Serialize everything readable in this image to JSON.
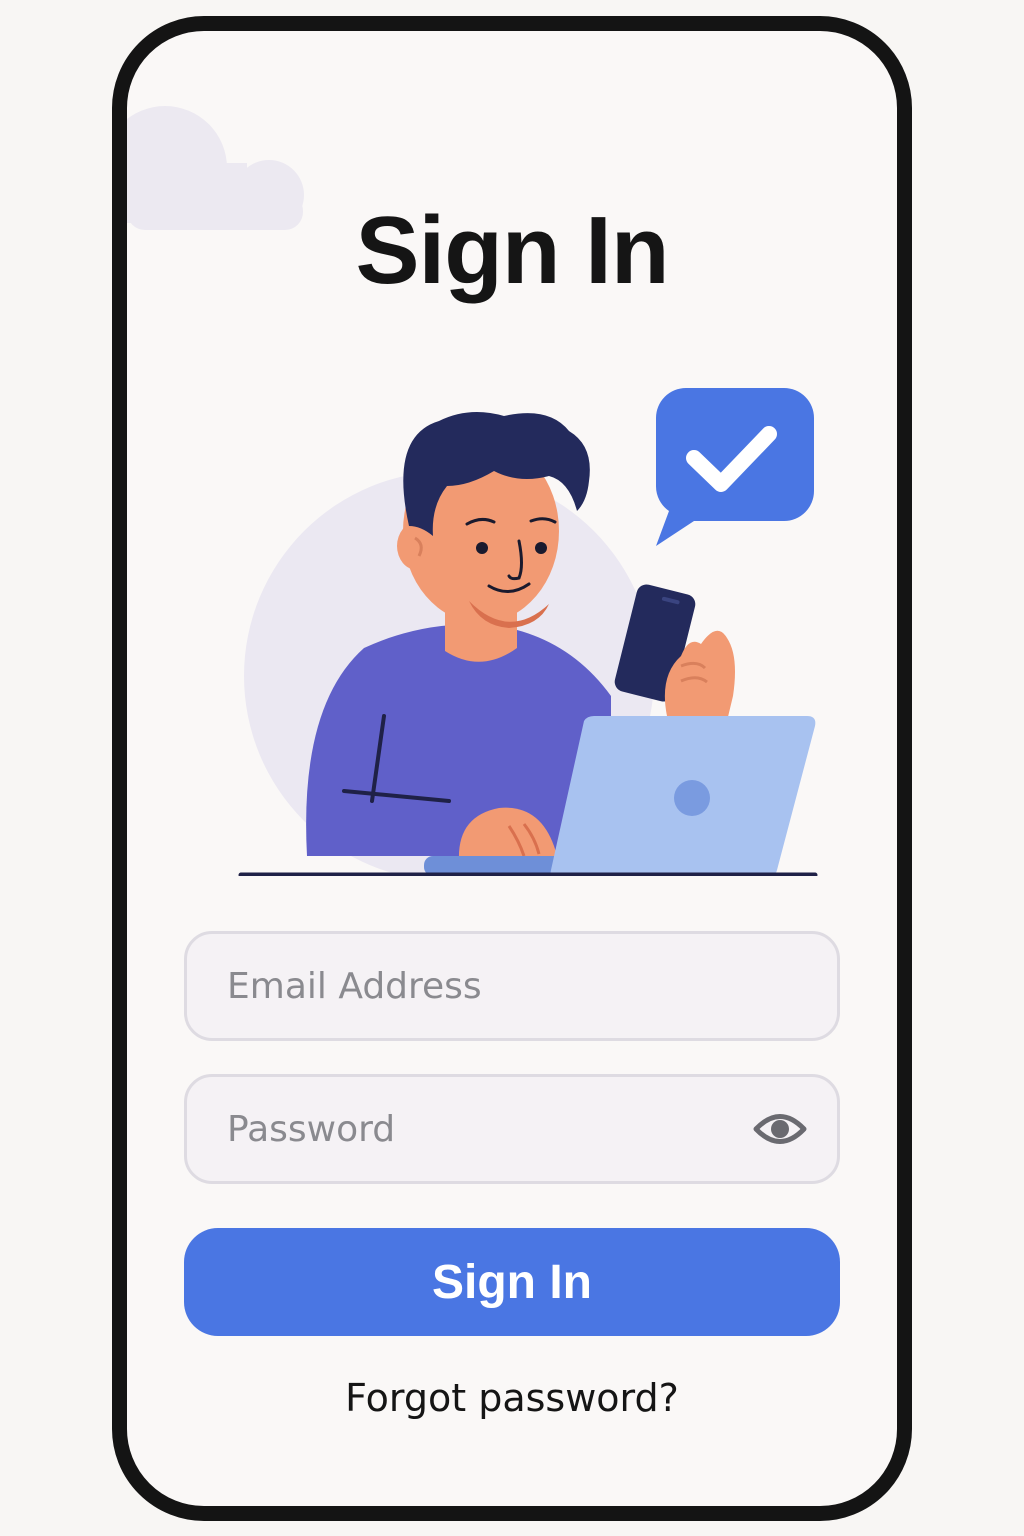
{
  "page": {
    "title": "Sign In"
  },
  "form": {
    "email": {
      "placeholder": "Email Address",
      "value": ""
    },
    "password": {
      "placeholder": "Password",
      "value": "",
      "toggle_icon": "eye-icon"
    },
    "submit_label": "Sign In",
    "forgot_label": "Forgot password?"
  },
  "illustration": {
    "subject": "person-using-phone-and-laptop",
    "badge_icon": "checkmark-chat-bubble-icon"
  },
  "colors": {
    "accent": "#4a76e3",
    "background": "#faf8f7",
    "frame": "#141414",
    "field_border": "#dedbe2",
    "field_background": "#f5f2f5",
    "placeholder": "#8a8a8f"
  }
}
